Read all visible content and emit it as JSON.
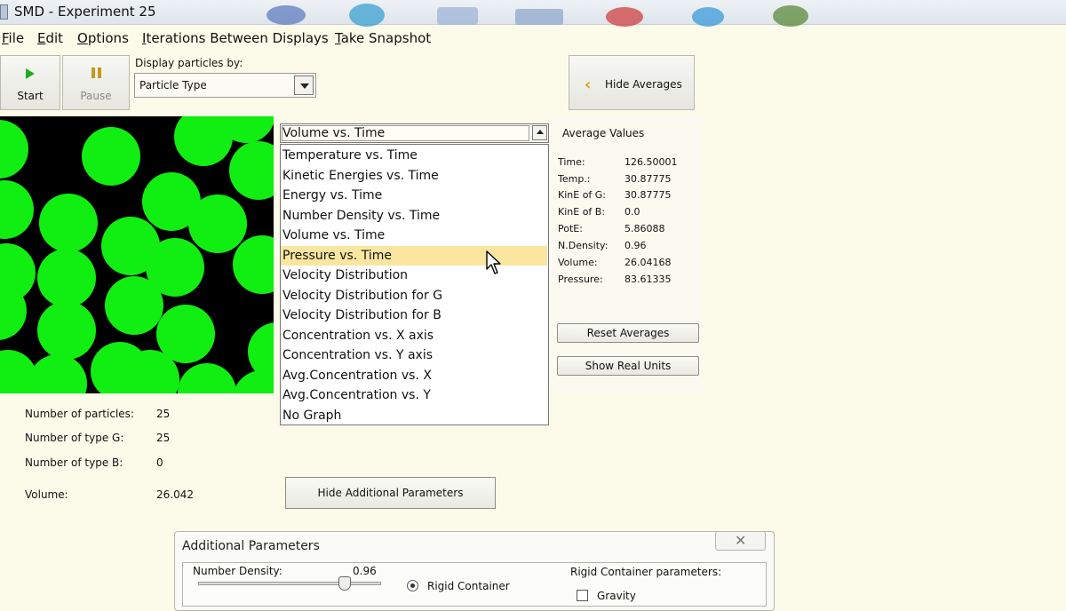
{
  "window": {
    "title": "SMD - Experiment 25"
  },
  "menu": [
    {
      "label": "File",
      "mnemonic": "F"
    },
    {
      "label": "Edit",
      "mnemonic": "E"
    },
    {
      "label": "Options",
      "mnemonic": "O"
    },
    {
      "label": "Iterations Between Displays",
      "mnemonic": "I"
    },
    {
      "label": "Take Snapshot",
      "mnemonic": "T"
    }
  ],
  "toolbar": {
    "start_label": "Start",
    "pause_label": "Pause",
    "display_by_label": "Display particles by:",
    "display_by_value": "Particle Type",
    "hide_averages_label": "Hide Averages"
  },
  "graph_select": {
    "selected": "Volume vs. Time",
    "highlighted": "Pressure vs. Time",
    "options": [
      "Temperature vs. Time",
      "Kinetic Energies vs. Time",
      "Energy vs. Time",
      "Number Density vs. Time",
      "Volume vs. Time",
      "Pressure vs. Time",
      "Velocity Distribution",
      "Velocity Distribution for G",
      "Velocity Distribution for B",
      "Concentration vs. X axis",
      "Concentration vs. Y axis",
      "Avg.Concentration vs. X",
      "Avg.Concentration vs. Y",
      "No Graph"
    ]
  },
  "averages": {
    "title": "Average Values",
    "rows": [
      {
        "label": "Time:",
        "value": "126.50001"
      },
      {
        "label": "Temp.:",
        "value": "30.87775"
      },
      {
        "label": "KinE of G:",
        "value": "30.87775"
      },
      {
        "label": "KinE of B:",
        "value": "0.0"
      },
      {
        "label": "PotE:",
        "value": "5.86088"
      },
      {
        "label": "N.Density:",
        "value": "0.96"
      },
      {
        "label": "Volume:",
        "value": "26.04168"
      },
      {
        "label": "Pressure:",
        "value": "83.61335"
      }
    ],
    "reset_label": "Reset Averages",
    "real_units_label": "Show Real Units"
  },
  "stats": [
    {
      "label": "Number of particles:",
      "value": "25"
    },
    {
      "label": "Number of type G:",
      "value": "25"
    },
    {
      "label": "Number of type B:",
      "value": "0"
    },
    {
      "label": "Volume:",
      "value": "26.042"
    }
  ],
  "hide_params_label": "Hide Additional Parameters",
  "additional": {
    "title": "Additional Parameters",
    "number_density_label": "Number Density:",
    "number_density_value": "0.96",
    "rigid_container_label": "Rigid Container",
    "rigid_params_label": "Rigid Container parameters:",
    "gravity_label": "Gravity"
  },
  "colors": {
    "particle_g": "#11ee11",
    "background": "#fcfbe9",
    "highlight": "#fbe6a0"
  }
}
